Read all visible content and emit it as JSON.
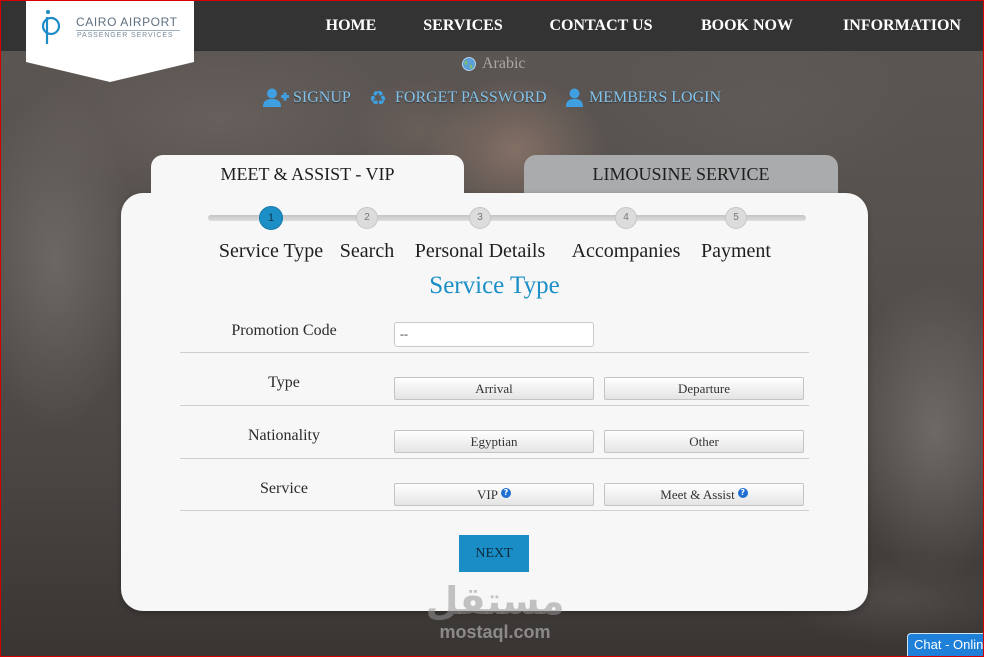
{
  "logo": {
    "line1": "CAIRO AIRPORT",
    "line2": "PASSENGER SERVICES",
    "icon": "cairo-airport-p-icon"
  },
  "nav": {
    "items": [
      {
        "label": "HOME"
      },
      {
        "label": "SERVICES"
      },
      {
        "label": "CONTACT US"
      },
      {
        "label": "BOOK NOW"
      },
      {
        "label": "INFORMATION"
      }
    ]
  },
  "language": {
    "label": "Arabic",
    "icon": "globe-icon"
  },
  "account_links": [
    {
      "label": "SIGNUP",
      "icon": "user-plus-icon"
    },
    {
      "label": "FORGET PASSWORD",
      "icon": "recycle-icon"
    },
    {
      "label": "MEMBERS LOGIN",
      "icon": "user-icon"
    }
  ],
  "tabs": [
    {
      "label": "MEET & ASSIST - VIP",
      "active": true
    },
    {
      "label": "LIMOUSINE SERVICE",
      "active": false
    }
  ],
  "steps": {
    "current": 1,
    "items": [
      {
        "number": "1",
        "label": "Service Type"
      },
      {
        "number": "2",
        "label": "Search"
      },
      {
        "number": "3",
        "label": "Personal Details"
      },
      {
        "number": "4",
        "label": "Accompanies"
      },
      {
        "number": "5",
        "label": "Payment"
      }
    ]
  },
  "form": {
    "title": "Service Type",
    "promotion_code": {
      "label": "Promotion Code",
      "value": "--"
    },
    "type": {
      "label": "Type",
      "options": [
        "Arrival",
        "Departure"
      ]
    },
    "nationality": {
      "label": "Nationality",
      "options": [
        "Egyptian",
        "Other"
      ]
    },
    "service": {
      "label": "Service",
      "options": [
        "VIP",
        "Meet & Assist"
      ],
      "info_icon": "question-circle-icon"
    },
    "next_label": "NEXT"
  },
  "chat": {
    "label": "Chat - Onlin"
  },
  "watermark": {
    "logo_text": "مستقل",
    "site": "mostaql.com"
  },
  "colors": {
    "accent": "#1b8fc6",
    "link": "#82c3ec",
    "link_icon": "#3f9fe0",
    "nav_bg": "#303030",
    "tab_inactive": "#a9abad",
    "panel_bg": "#f7f7f7",
    "chat_bg": "#1e80d8"
  }
}
